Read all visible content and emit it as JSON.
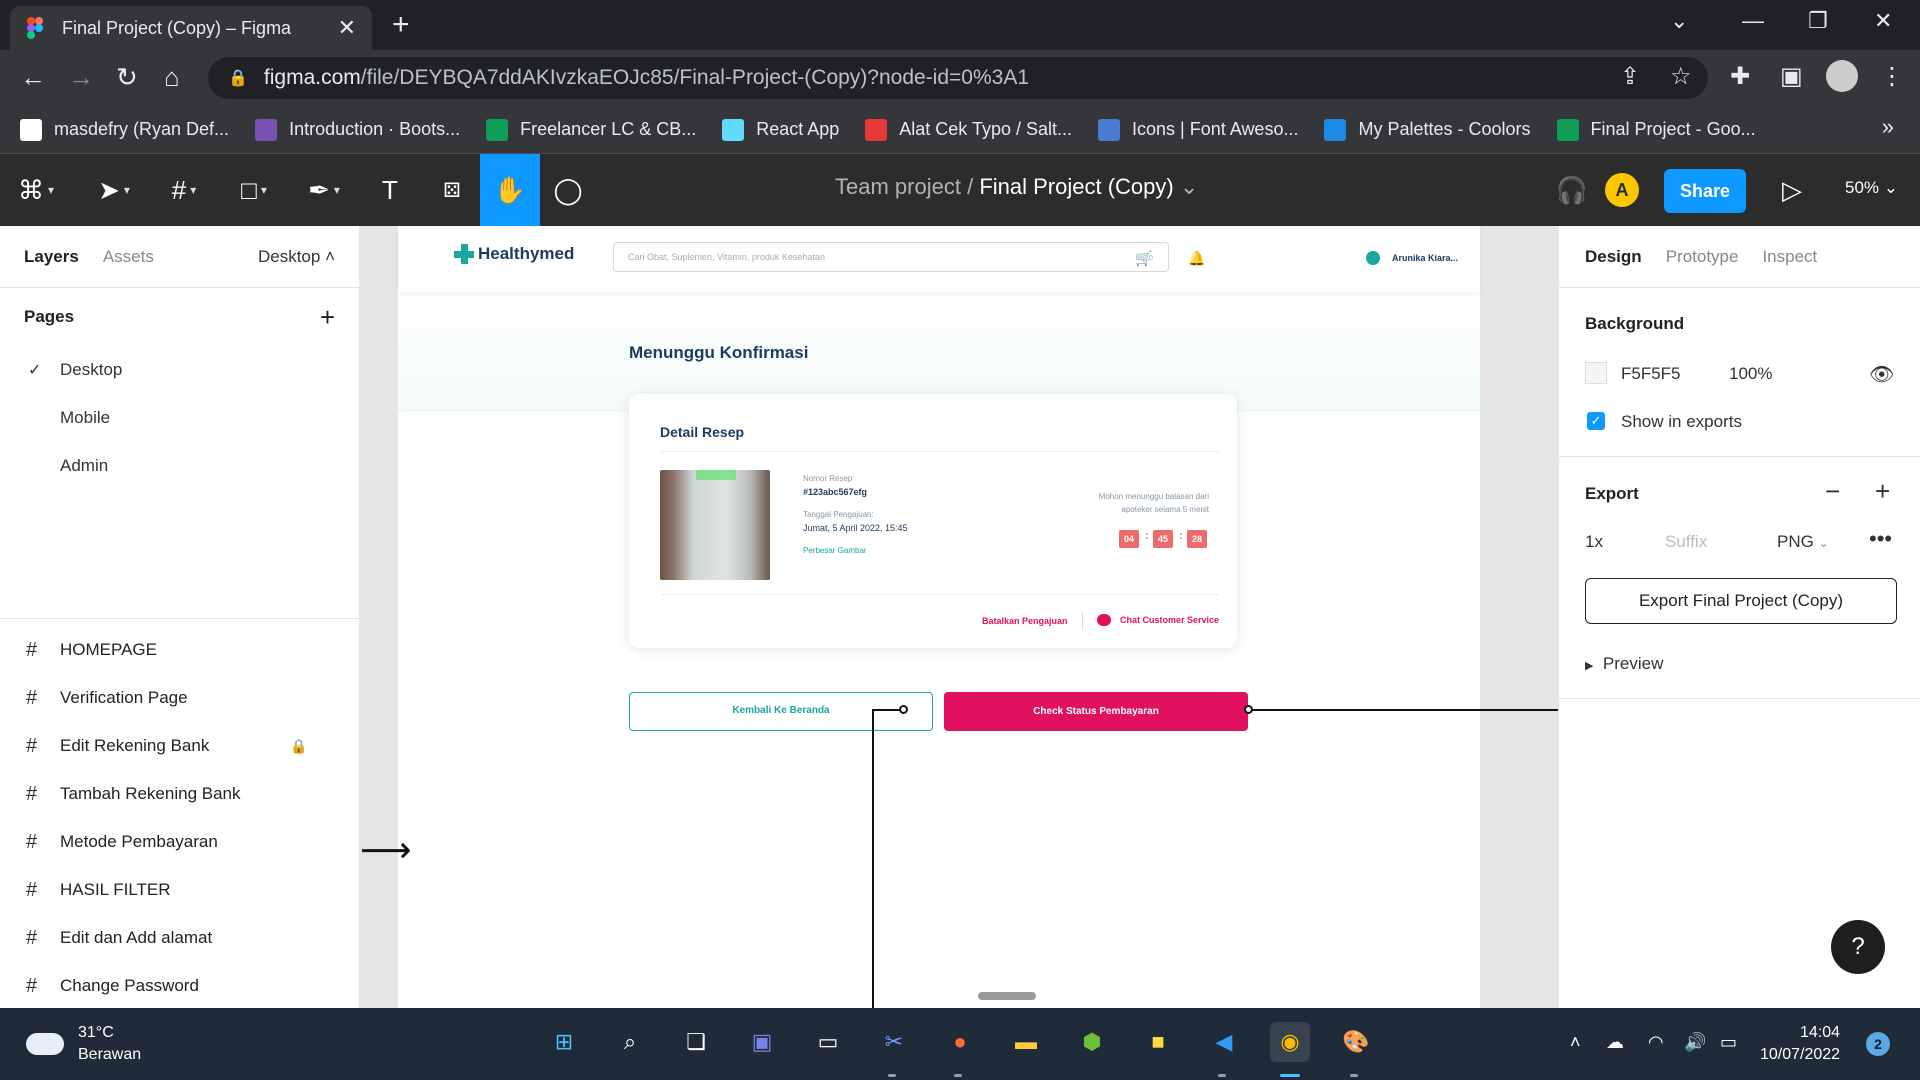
{
  "browser": {
    "tab_title": "Final Project (Copy) – Figma",
    "url_host": "figma.com",
    "url_path": "/file/DEYBQA7ddAKIvzkaEOJc85/Final-Project-(Copy)?node-id=0%3A1",
    "bookmarks": [
      {
        "label": "masdefry (Ryan Def...",
        "icon": "github-icon",
        "color": "#ffffff"
      },
      {
        "label": "Introduction · Boots...",
        "icon": "bootstrap-icon",
        "color": "#7952b3"
      },
      {
        "label": "Freelancer LC & CB...",
        "icon": "sheets-icon",
        "color": "#0f9d58"
      },
      {
        "label": "React App",
        "icon": "react-icon",
        "color": "#61dafb"
      },
      {
        "label": "Alat Cek Typo / Salt...",
        "icon": "check-shield-icon",
        "color": "#e53935"
      },
      {
        "label": "Icons | Font Aweso...",
        "icon": "flag-icon",
        "color": "#4a7bd0"
      },
      {
        "label": "My Palettes - Coolors",
        "icon": "coolors-icon",
        "color": "#1e88e5"
      },
      {
        "label": "Final Project - Goo...",
        "icon": "sheets-icon",
        "color": "#0f9d58"
      }
    ],
    "more_label": "»"
  },
  "figma": {
    "project_team": "Team project",
    "project_sep": "/",
    "project_name": "Final Project (Copy)",
    "avatar_letter": "A",
    "share_label": "Share",
    "zoom": "50%"
  },
  "left_panel": {
    "tab_layers": "Layers",
    "tab_assets": "Assets",
    "page_dropdown": "Desktop",
    "pages_label": "Pages",
    "pages": [
      "Desktop",
      "Mobile",
      "Admin"
    ],
    "layers": [
      "HOMEPAGE",
      "Verification Page",
      "Edit Rekening Bank",
      "Tambah Rekening Bank",
      "Metode Pembayaran",
      "HASIL FILTER",
      "Edit dan Add alamat",
      "Change Password"
    ]
  },
  "design": {
    "logo": "Healthymed",
    "search_placeholder": "Cari Obat, Suplemen, Vitamin, produk Kesehatan",
    "user_name": "Arunika Kiara...",
    "heading": "Menunggu Konfirmasi",
    "card_title": "Detail Resep",
    "nomor_label": "Nomor Resep",
    "nomor_value": "#123abc567efg",
    "tanggal_label": "Tanggal Pengajuan:",
    "tanggal_value": "Jumat, 5 April 2022, 15:45",
    "enlarge_link": "Perbesar Gambar",
    "wait_text": "Mohon menunggu balasan dari apoteker selama 5 menit",
    "timer": [
      "04",
      "45",
      "28"
    ],
    "cancel_label": "Batalkan Pengajuan",
    "chat_label": "Chat Customer Service",
    "btn_back": "Kembali Ke Beranda",
    "btn_check": "Check Status Pembayaran",
    "accent_teal": "#19a89d",
    "accent_pink": "#e0115f"
  },
  "right_panel": {
    "tab_design": "Design",
    "tab_prototype": "Prototype",
    "tab_inspect": "Inspect",
    "background_title": "Background",
    "bg_hex": "F5F5F5",
    "bg_opacity": "100%",
    "show_in_exports": "Show in exports",
    "export_title": "Export",
    "export_scale": "1x",
    "export_suffix_placeholder": "Suffix",
    "export_format": "PNG",
    "export_button": "Export Final Project (Copy)",
    "preview_label": "Preview",
    "help": "?"
  },
  "taskbar": {
    "temp": "31°C",
    "weather": "Berawan",
    "time": "14:04",
    "date": "10/07/2022",
    "notifications": "2"
  }
}
